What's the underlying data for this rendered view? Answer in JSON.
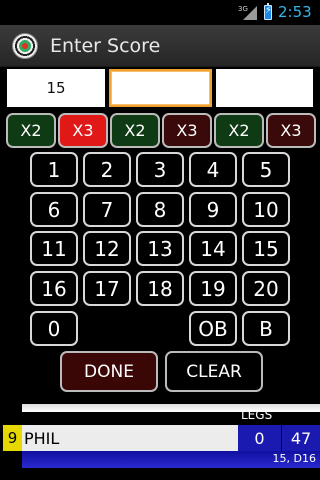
{
  "status_bar": {
    "network": "3G",
    "time": "2:53",
    "icons": [
      "signal-icon",
      "battery-charging-icon"
    ]
  },
  "action_bar": {
    "title": "Enter Score",
    "icon": "dartboard-icon"
  },
  "darts": {
    "dart1": "15",
    "dart2": "",
    "dart3": ""
  },
  "multipliers": [
    "X2",
    "X3",
    "X2",
    "X3",
    "X2",
    "X3"
  ],
  "multiplier_active_index": 1,
  "keypad": {
    "row1": [
      "1",
      "2",
      "3",
      "4",
      "5"
    ],
    "row2": [
      "6",
      "7",
      "8",
      "9",
      "10"
    ],
    "row3": [
      "11",
      "12",
      "13",
      "14",
      "15"
    ],
    "row4": [
      "16",
      "17",
      "18",
      "19",
      "20"
    ],
    "zero": "0",
    "outer_bull": "OB",
    "bull": "B"
  },
  "actions": {
    "done": "DONE",
    "clear": "CLEAR"
  },
  "scoreboard": {
    "legs_header": "LEGS",
    "player": {
      "seat": "9",
      "name": "PHIL",
      "legs": "0",
      "remaining": "47",
      "checkout": "15, D16"
    }
  },
  "colors": {
    "x2": "#0e3a14",
    "x3": "#3a0a0a",
    "x3_active": "#e01818",
    "focus": "#f0a030",
    "scoreboard_blue": "#1a1ab0",
    "seat_yellow": "#e6d800"
  }
}
